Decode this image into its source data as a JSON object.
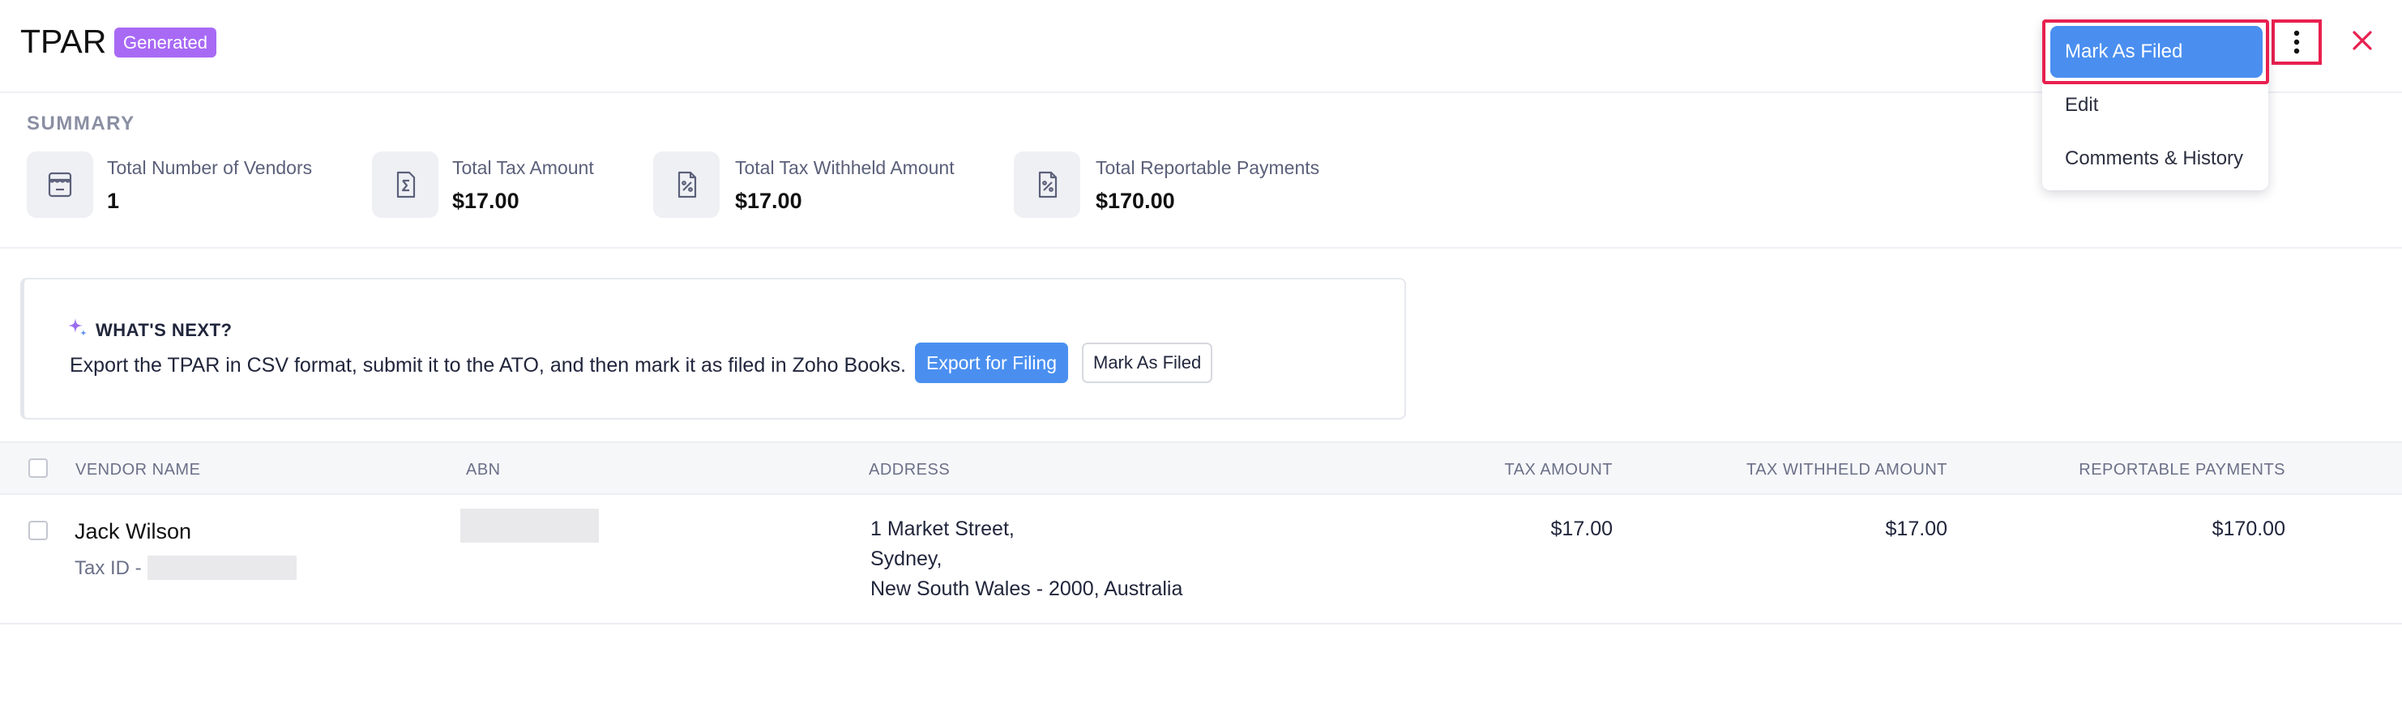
{
  "header": {
    "title": "TPAR",
    "badge": "Generated"
  },
  "dropdown": {
    "items": [
      "Mark As Filed",
      "Edit",
      "Comments & History"
    ]
  },
  "summary": {
    "label": "SUMMARY",
    "stats": [
      {
        "label": "Total Number of Vendors",
        "value": "1",
        "icon": "store-icon"
      },
      {
        "label": "Total Tax Amount",
        "value": "$17.00",
        "icon": "sigma-document-icon"
      },
      {
        "label": "Total Tax Withheld Amount",
        "value": "$17.00",
        "icon": "percent-document-icon"
      },
      {
        "label": "Total Reportable Payments",
        "value": "$170.00",
        "icon": "percent-document-icon"
      }
    ]
  },
  "whats_next": {
    "heading": "WHAT'S NEXT?",
    "text": "Export the TPAR in CSV format, submit it to the ATO, and then mark it as filed in Zoho Books.",
    "export_label": "Export for Filing",
    "mark_label": "Mark As Filed"
  },
  "table": {
    "columns": [
      "VENDOR NAME",
      "ABN",
      "ADDRESS",
      "TAX AMOUNT",
      "TAX WITHHELD AMOUNT",
      "REPORTABLE PAYMENTS"
    ],
    "rows": [
      {
        "vendor_name": "Jack Wilson",
        "tax_id_label": "Tax ID -",
        "address": [
          "1 Market Street,",
          "Sydney,",
          "New South Wales - 2000, Australia"
        ],
        "tax_amount": "$17.00",
        "tax_withheld_amount": "$17.00",
        "reportable_payments": "$170.00"
      }
    ]
  },
  "colors": {
    "primary": "#4a8ff0",
    "badge": "#a86af5",
    "highlight": "#e8204f",
    "close": "#e8204f"
  }
}
